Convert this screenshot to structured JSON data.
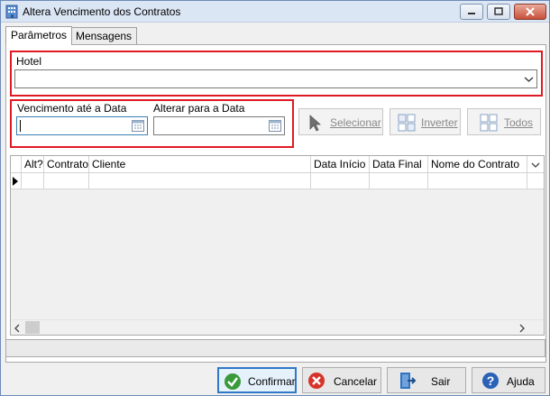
{
  "window": {
    "title": "Altera Vencimento dos Contratos"
  },
  "tabs": [
    {
      "label": "Parâmetros",
      "active": true
    },
    {
      "label": "Mensagens",
      "active": false
    }
  ],
  "hotel": {
    "label": "Hotel",
    "value": ""
  },
  "dates": {
    "vencimento_label": "Vencimento até a Data",
    "vencimento_value": "",
    "alterar_label": "Alterar para a Data",
    "alterar_value": ""
  },
  "select_buttons": {
    "selecionar": "Selecionar",
    "inverter": "Inverter",
    "todos": "Todos"
  },
  "grid": {
    "columns": [
      "Alt?",
      "Contrato",
      "Cliente",
      "Data Início",
      "Data Final",
      "Nome do Contrato"
    ],
    "rows": [
      [
        "",
        "",
        "",
        "",
        "",
        ""
      ]
    ]
  },
  "actions": {
    "confirmar": "Confirmar",
    "cancelar": "Cancelar",
    "sair": "Sair",
    "ajuda": "Ajuda"
  },
  "colors": {
    "highlight_border": "#e01a24",
    "primary_border": "#2e78c8",
    "confirm_icon": "#3a9a3a",
    "cancel_icon": "#d6342a",
    "exit_icon": "#2f74c0",
    "help_icon": "#2a62b8"
  }
}
